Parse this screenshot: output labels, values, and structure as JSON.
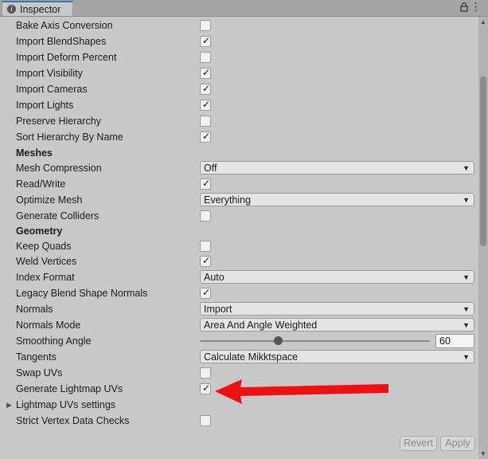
{
  "window": {
    "tab_title": "Inspector",
    "tab_icon": "info-icon"
  },
  "rows": {
    "bake_axis_conversion": {
      "label": "Bake Axis Conversion",
      "checked": false
    },
    "import_blendshapes": {
      "label": "Import BlendShapes",
      "checked": true
    },
    "import_deform_percent": {
      "label": "Import Deform Percent",
      "checked": false
    },
    "import_visibility": {
      "label": "Import Visibility",
      "checked": true
    },
    "import_cameras": {
      "label": "Import Cameras",
      "checked": true
    },
    "import_lights": {
      "label": "Import Lights",
      "checked": true
    },
    "preserve_hierarchy": {
      "label": "Preserve Hierarchy",
      "checked": false
    },
    "sort_hierarchy_by_name": {
      "label": "Sort Hierarchy By Name",
      "checked": true
    },
    "meshes_header": {
      "label": "Meshes"
    },
    "mesh_compression": {
      "label": "Mesh Compression",
      "value": "Off"
    },
    "read_write": {
      "label": "Read/Write",
      "checked": true
    },
    "optimize_mesh": {
      "label": "Optimize Mesh",
      "value": "Everything"
    },
    "generate_colliders": {
      "label": "Generate Colliders",
      "checked": false
    },
    "geometry_header": {
      "label": "Geometry"
    },
    "keep_quads": {
      "label": "Keep Quads",
      "checked": false
    },
    "weld_vertices": {
      "label": "Weld Vertices",
      "checked": true
    },
    "index_format": {
      "label": "Index Format",
      "value": "Auto"
    },
    "legacy_blend_shape_normals": {
      "label": "Legacy Blend Shape Normals",
      "checked": true
    },
    "normals": {
      "label": "Normals",
      "value": "Import"
    },
    "normals_mode": {
      "label": "Normals Mode",
      "value": "Area And Angle Weighted"
    },
    "smoothing_angle": {
      "label": "Smoothing Angle",
      "value": "60",
      "min": 0,
      "max": 180
    },
    "tangents": {
      "label": "Tangents",
      "value": "Calculate Mikktspace"
    },
    "swap_uvs": {
      "label": "Swap UVs",
      "checked": false
    },
    "generate_lightmap_uvs": {
      "label": "Generate Lightmap UVs",
      "checked": true
    },
    "lightmap_uvs_settings": {
      "label": "Lightmap UVs settings",
      "expanded": false
    },
    "strict_vertex_data_checks": {
      "label": "Strict Vertex Data Checks",
      "checked": false
    }
  },
  "footer": {
    "revert_label": "Revert",
    "apply_label": "Apply"
  },
  "colors": {
    "tab_accent": "#3a72b0",
    "annotation_arrow": "#ee1111",
    "panel_bg": "#c8c8c8"
  }
}
